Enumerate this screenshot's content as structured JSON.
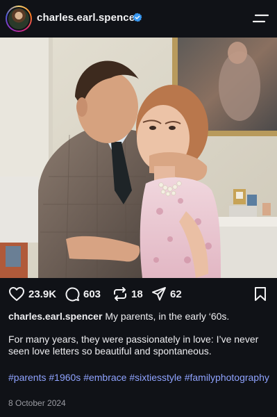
{
  "header": {
    "username": "charles.earl.spencer",
    "verified_color": "#3897f0",
    "avatar_icon": "profile-avatar",
    "menu_icon": "hamburger-menu-icon"
  },
  "post": {
    "image_alt": "Couple embracing in a living room, 1960s colorized photo"
  },
  "actions": {
    "likes": "23.9K",
    "comments": "603",
    "reposts": "18",
    "shares": "62"
  },
  "caption": {
    "username": "charles.earl.spencer",
    "line1": "My parents, in the early ‘60s.",
    "line2": "For many years, they were passionately in love: I’ve never seen love letters so beautiful and spontaneous."
  },
  "hashtags": "#parents #1960s #embrace #sixtiesstyle #familyphotography",
  "date": "8 October 2024",
  "colors": {
    "background": "#101217",
    "hashtag": "#8fa3ff"
  }
}
